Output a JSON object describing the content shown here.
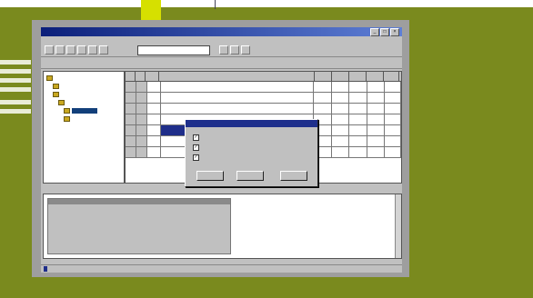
{
  "window": {
    "title": "",
    "controls": [
      "_",
      "□",
      "×"
    ]
  },
  "menu": {
    "items": []
  },
  "toolbar": {
    "combo_value": ""
  },
  "toolbar2": {
    "items": []
  },
  "tree": {
    "items": []
  },
  "grid": {
    "columns": [],
    "rows": []
  },
  "dialog": {
    "title": "",
    "options": [],
    "buttons": []
  },
  "status": {
    "text": "",
    "highlight": ""
  }
}
